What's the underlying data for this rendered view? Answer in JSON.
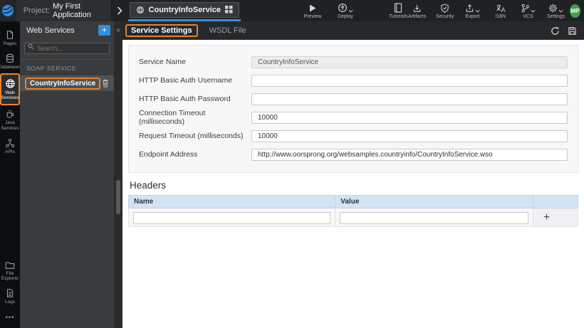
{
  "topbar": {
    "project_label": "Project:",
    "project_name": "My First Application",
    "service_tab": {
      "label": "CountryInfoService"
    },
    "actions": {
      "preview": "Preview",
      "deploy": "Deploy",
      "tutorials": "Tutorials",
      "artifacts": "Artifacts",
      "security": "Security",
      "export": "Export",
      "i18n": "I18N",
      "vcs": "VCS",
      "settings": "Settings"
    },
    "avatar": "MP"
  },
  "rail": {
    "items": [
      {
        "label": "Pages",
        "selected": false
      },
      {
        "label": "Databases",
        "selected": false
      },
      {
        "label": "Web Services",
        "selected": true
      },
      {
        "label": "Java Services",
        "selected": false
      },
      {
        "label": "APIs",
        "selected": false
      },
      {
        "label": "File Explorer",
        "selected": false
      },
      {
        "label": "Logs",
        "selected": false
      }
    ],
    "more": "•••"
  },
  "panel": {
    "title": "Web Services",
    "add_button": "+",
    "collapse": "«",
    "search_placeholder": "Search...",
    "section_label": "SOAP SERVICE",
    "service_name": "CountryInfoService"
  },
  "tabs": {
    "active": "Service Settings",
    "inactive": "WSDL File"
  },
  "form": {
    "fields": [
      {
        "label": "Service Name",
        "value": "CountryInfoService",
        "disabled": true
      },
      {
        "label": "HTTP Basic Auth Username",
        "value": ""
      },
      {
        "label": "HTTP Basic Auth Password",
        "value": ""
      },
      {
        "label": "Connection Timeout (milliseconds)",
        "value": "10000"
      },
      {
        "label": "Request Timeout (milliseconds)",
        "value": "10000"
      },
      {
        "label": "Endpoint Address",
        "value": "http://www.oorsprong.org/websamples.countryinfo/CountryInfoService.wso"
      }
    ]
  },
  "headers_section": {
    "title": "Headers",
    "columns": [
      "Name",
      "Value"
    ],
    "add_label": "+",
    "row": {
      "name": "",
      "value": ""
    }
  },
  "colors": {
    "annotation_orange": "#e8832c",
    "add_button_blue": "#2e8fdf",
    "tab_underline_blue": "#3f8fd2",
    "avatar_green": "#43a047",
    "table_header_blue": "#d2e4f3"
  }
}
